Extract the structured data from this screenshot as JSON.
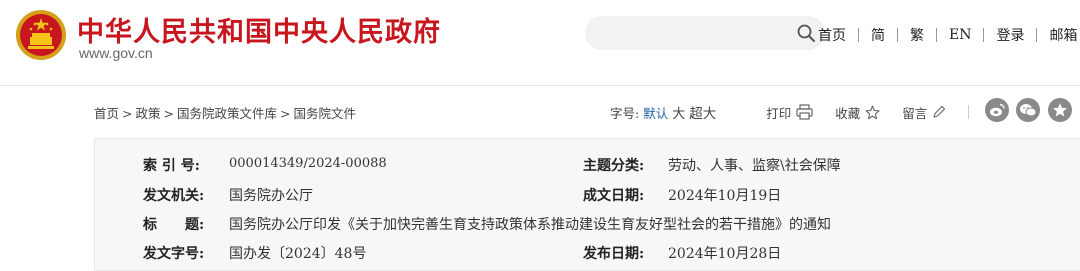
{
  "header": {
    "site_name": "中华人民共和国中央人民政府",
    "domain": "www.gov.cn",
    "nav": [
      "首页",
      "简",
      "繁",
      "EN",
      "登录",
      "邮箱"
    ]
  },
  "breadcrumb": [
    "首页",
    "政策",
    "国务院政策文件库",
    "国务院文件"
  ],
  "breadcrumb_separator": ">",
  "toolbar": {
    "font_size_label": "字号:",
    "sizes": [
      "默认",
      "大",
      "超大"
    ],
    "print_label": "打印",
    "favorite_label": "收藏",
    "comment_label": "留言"
  },
  "doc_info": {
    "index_label": "索 引 号:",
    "index_value": "000014349/2024-00088",
    "topic_label": "主题分类:",
    "topic_value": "劳动、人事、监察\\社会保障",
    "issuer_label": "发文机关:",
    "issuer_value": "国务院办公厅",
    "created_label": "成文日期:",
    "created_value": "2024年10月19日",
    "title_label": "标　　题:",
    "title_value": "国务院办公厅印发《关于加快完善生育支持政策体系推动建设生育友好型社会的若干措施》的通知",
    "doc_no_label": "发文字号:",
    "doc_no_value": "国办发〔2024〕48号",
    "published_label": "发布日期:",
    "published_value": "2024年10月28日"
  },
  "colors": {
    "brand_red": "#c8161e",
    "active_blue": "#1e62a8",
    "panel_bg": "#f7f7f7"
  }
}
